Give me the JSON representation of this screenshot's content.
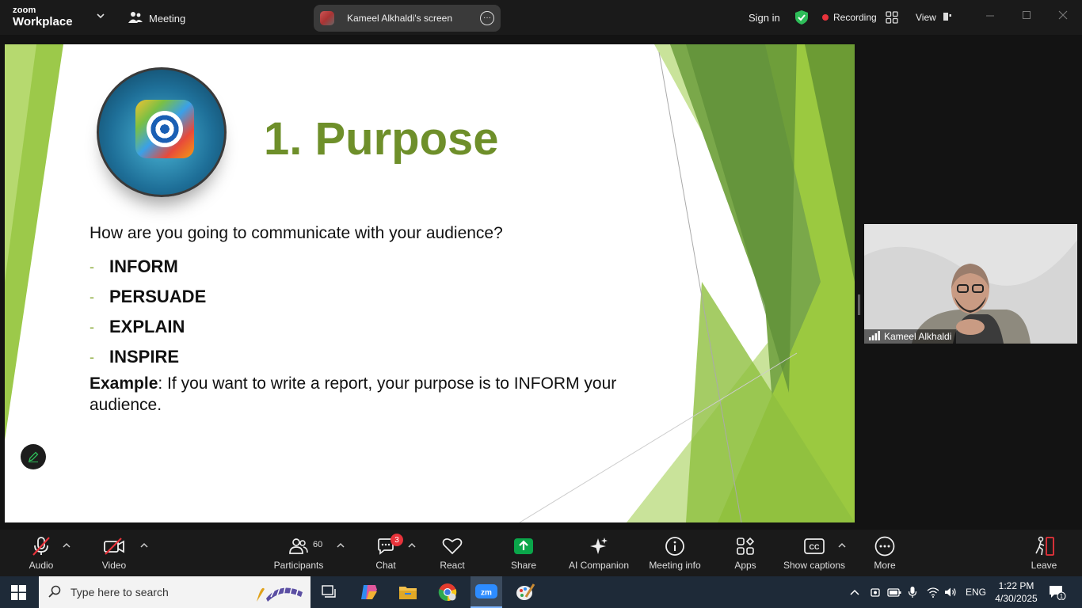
{
  "app": {
    "brand_top": "zoom",
    "brand_bottom": "Workplace",
    "meeting_tab": "Meeting",
    "share_title": "Kameel Alkhaldi's screen",
    "sign_in": "Sign in",
    "recording": "Recording",
    "view": "View"
  },
  "slide": {
    "title": "1. Purpose",
    "question": "How are you going to communicate with your audience?",
    "bullet_marker": "-",
    "bullets": [
      "INFORM",
      "PERSUADE",
      "EXPLAIN",
      "INSPIRE"
    ],
    "example_label": "Example",
    "example_text": ": If you want to write a report, your purpose is to INFORM your audience."
  },
  "participant": {
    "name": "Kameel Alkhaldi"
  },
  "toolbar": {
    "audio": "Audio",
    "video": "Video",
    "participants": "Participants",
    "participants_count": "60",
    "chat": "Chat",
    "chat_badge": "3",
    "react": "React",
    "share": "Share",
    "ai_companion": "AI Companion",
    "meeting_info": "Meeting info",
    "apps": "Apps",
    "show_captions": "Show captions",
    "more": "More",
    "leave": "Leave"
  },
  "taskbar": {
    "search_placeholder": "Type here to search",
    "lang": "ENG",
    "time": "1:22 PM",
    "date": "4/30/2025",
    "notif_count": "1"
  },
  "colors": {
    "title_green": "#6e8f2a",
    "accent_green": "#8dc63f",
    "recording_red": "#e8333b",
    "share_green": "#0aa64a"
  }
}
